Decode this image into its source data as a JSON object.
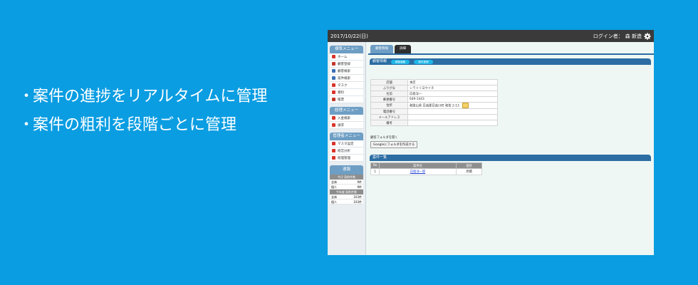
{
  "bullets": [
    {
      "marker": "・",
      "text": "案件の進捗をリアルタイムに管理"
    },
    {
      "marker": "・",
      "text": "案件の粗利を段階ごとに管理"
    }
  ],
  "app": {
    "date": "2017/10/22(日)",
    "login_label": "ログイン者：",
    "user_name": "森 新造",
    "menus": [
      {
        "title": "標準メニュー",
        "items": [
          {
            "label": "ホーム",
            "icon": "home-icon",
            "color": "#d9342b"
          },
          {
            "label": "顧客登録",
            "icon": "customer-register-icon",
            "color": "#c0392b"
          },
          {
            "label": "顧客検索",
            "icon": "customer-search-icon",
            "color": "#3b6fb6"
          },
          {
            "label": "案件検索",
            "icon": "case-search-icon",
            "color": "#3b6fb6"
          },
          {
            "label": "タスク",
            "icon": "task-icon",
            "color": "#d9342b"
          },
          {
            "label": "資料",
            "icon": "folder-icon",
            "color": "#d9342b"
          },
          {
            "label": "帳票",
            "icon": "form-icon",
            "color": "#c0392b"
          }
        ]
      },
      {
        "title": "経理メニュー",
        "items": [
          {
            "label": "入金検索",
            "icon": "payment-search-icon",
            "color": "#d9342b"
          },
          {
            "label": "請求",
            "icon": "invoice-icon",
            "color": "#d9342b"
          }
        ]
      },
      {
        "title": "管理者メニュー",
        "items": [
          {
            "label": "マスタ設定",
            "icon": "master-settings-icon",
            "color": "#d9342b"
          },
          {
            "label": "経営分析",
            "icon": "analysis-icon",
            "color": "#d9342b"
          },
          {
            "label": "経理管理",
            "icon": "accounting-icon",
            "color": "#d9342b"
          }
        ]
      }
    ],
    "stats": {
      "title": "速報",
      "groups": [
        {
          "subtitle": "今月 契約件数",
          "rows": [
            {
              "label": "全体",
              "value": "9件"
            },
            {
              "label": "個人",
              "value": "9件"
            }
          ]
        },
        {
          "subtitle": "今年度 契約件数",
          "rows": [
            {
              "label": "全体",
              "value": "103件"
            },
            {
              "label": "個人",
              "value": "103件"
            }
          ]
        }
      ]
    },
    "tabs": [
      {
        "label": "顧客情報",
        "active": true
      },
      {
        "label": "詳細",
        "active": false
      }
    ],
    "customer": {
      "title": "顧客情報",
      "edit_button": "顧客編集",
      "new_case_button": "案件登録",
      "fields": [
        {
          "label": "店舗",
          "value": "本店"
        },
        {
          "label": "ふりがな",
          "value": "シラトリヨウイチ"
        },
        {
          "label": "名前",
          "value": "白鳥洋一"
        },
        {
          "label": "郵便番号",
          "value": "649-1443"
        },
        {
          "label": "住所",
          "value": "和歌山県 日高郡日高川町 和佐 2-13",
          "map": true
        },
        {
          "label": "電話番号",
          "value": ""
        },
        {
          "label": "メールアドレス",
          "value": ""
        },
        {
          "label": "備考",
          "value": ""
        }
      ]
    },
    "folder": {
      "label": "顧客フォルダを開く",
      "button": "Googleにフォルダを作成する"
    },
    "cases": {
      "title": "案件一覧",
      "headers": [
        "No",
        "案件名",
        "進捗"
      ],
      "rows": [
        {
          "no": "1",
          "name": "白鳥洋一邸",
          "status": "見積"
        }
      ]
    }
  }
}
